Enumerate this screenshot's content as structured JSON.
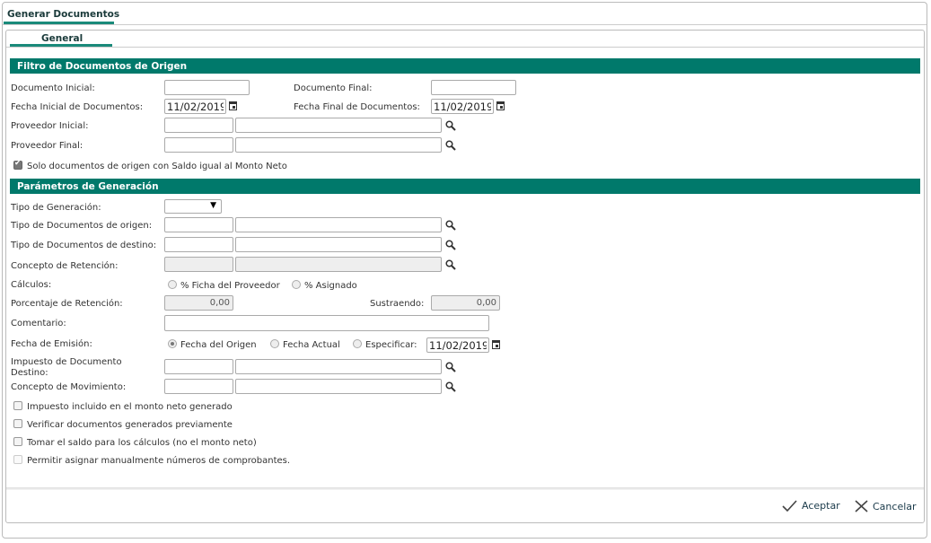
{
  "window_tab": "Generar Documentos",
  "sub_tab": "General",
  "section1": {
    "title": "Filtro de Documentos de Origen",
    "doc_inicial_label": "Documento Inicial:",
    "doc_final_label": "Documento Final:",
    "fecha_inicial_label": "Fecha Inicial de Documentos:",
    "fecha_inicial": "11/02/2019",
    "fecha_final_label": "Fecha Final de Documentos:",
    "fecha_final": "11/02/2019",
    "prov_inicial_label": "Proveedor Inicial:",
    "prov_final_label": "Proveedor Final:",
    "solo_saldo_label": "Solo documentos de origen con Saldo igual al Monto Neto",
    "solo_saldo_checked": true
  },
  "section2": {
    "title": "Parámetros de Generación",
    "tipo_gen_label": "Tipo de Generación:",
    "tipo_gen_value": "",
    "tipo_orig_label": "Tipo de Documentos de origen:",
    "tipo_dest_label": "Tipo de Documentos de destino:",
    "concepto_ret_label": "Concepto de Retención:",
    "calculos_label": "Cálculos:",
    "calc_opt1": "% Ficha del Proveedor",
    "calc_opt2": "% Asignado",
    "porcentaje_label": "Porcentaje de Retención:",
    "porcentaje": "0,00",
    "sustraendo_label": "Sustraendo:",
    "sustraendo": "0,00",
    "comentario_label": "Comentario:",
    "fecha_emision_label": "Fecha de Emisión:",
    "fe_opt1": "Fecha del Origen",
    "fe_opt2": "Fecha Actual",
    "fe_opt3": "Especificar:",
    "fecha_especificar": "11/02/2019",
    "impuesto_label_1": "Impuesto de Documento",
    "impuesto_label_2": "Destino:",
    "concepto_mov_label": "Concepto de Movimiento:",
    "chk1": "Impuesto incluido en el monto neto generado",
    "chk2": "Verificar documentos generados previamente",
    "chk3": "Tomar el saldo para los cálculos (no el monto neto)",
    "chk4": "Permitir asignar manualmente números de comprobantes."
  },
  "footer": {
    "accept": "Aceptar",
    "cancel": "Cancelar"
  }
}
